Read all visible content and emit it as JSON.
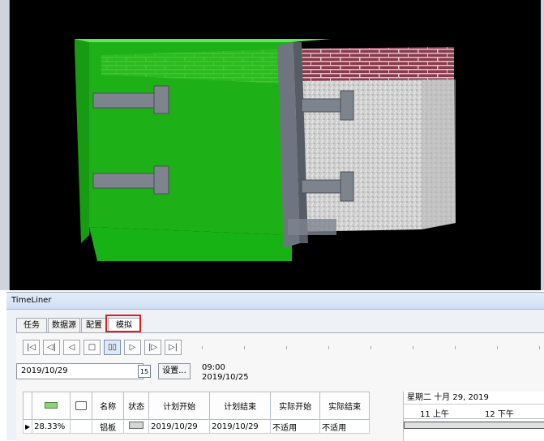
{
  "panel": {
    "title": "TimeLiner"
  },
  "tabs": [
    "任务",
    "数据源",
    "配置",
    "模拟"
  ],
  "active_tab": "模拟",
  "playback": {
    "buttons": [
      "go-to-start",
      "step-back",
      "play-reverse",
      "stop",
      "pause",
      "play",
      "step-forward",
      "go-to-end"
    ],
    "labels": [
      "|◁",
      "◁|",
      "◁",
      "□",
      "▯▯",
      "▷",
      "|▷",
      "▷|"
    ]
  },
  "sim": {
    "date": "2019/10/29",
    "calendar_day": "15",
    "settings_label": "设置...",
    "time": "09:00",
    "time_date": "2019/10/25"
  },
  "table": {
    "headers": [
      "",
      "",
      "名称",
      "状态",
      "计划开始",
      "计划结束",
      "实际开始",
      "实际结束"
    ],
    "rows": [
      {
        "progress": "28.33%",
        "name": "铝板",
        "planned_start": "2019/10/29",
        "planned_end": "2019/10/29",
        "actual_start": "不适用",
        "actual_end": "不适用"
      }
    ]
  },
  "gantt": {
    "date_header": "星期二 十月 29, 2019",
    "slots": [
      "11 上午",
      "12 下午"
    ]
  },
  "colors": {
    "accent_green": "#22c91a",
    "highlight_red": "#e02020",
    "brick": "#8a3b4a",
    "steel": "#6f7580"
  }
}
